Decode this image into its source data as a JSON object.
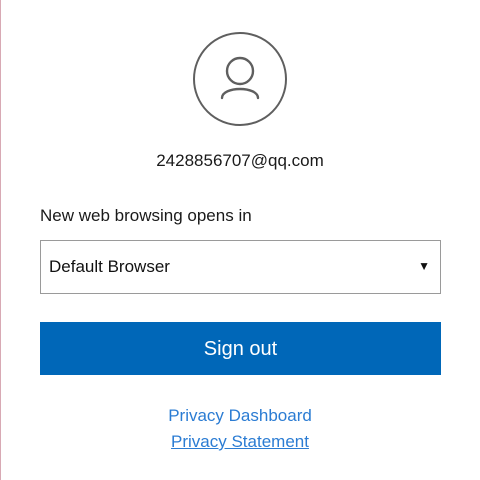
{
  "account": {
    "avatar_icon": "person-icon",
    "email": "2428856707@qq.com"
  },
  "browsing_setting": {
    "label": "New web browsing opens in",
    "selected_value": "Default Browser",
    "arrow_glyph": "▼"
  },
  "actions": {
    "sign_out_label": "Sign out"
  },
  "links": {
    "privacy_dashboard": "Privacy Dashboard",
    "privacy_statement": "Privacy Statement"
  },
  "colors": {
    "primary_button": "#0067b8",
    "link": "#2b7cd3"
  }
}
